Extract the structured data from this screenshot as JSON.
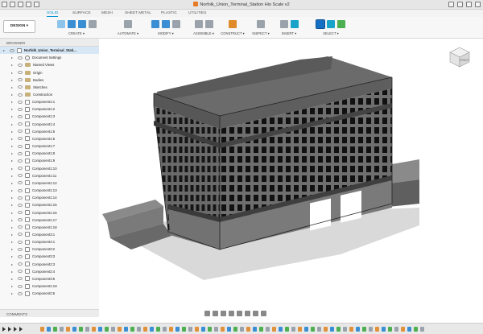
{
  "window": {
    "title": "Norfolk_Union_Terminal_Station Hio Scale v2"
  },
  "ribbon": {
    "tabs": [
      {
        "label": "SOLID",
        "active": true
      },
      {
        "label": "SURFACE",
        "active": false
      },
      {
        "label": "MESH",
        "active": false
      },
      {
        "label": "SHEET METAL",
        "active": false
      },
      {
        "label": "PLASTIC",
        "active": false
      },
      {
        "label": "UTILITIES",
        "active": false
      }
    ],
    "workspace_label": "DESIGN ▾",
    "groups": [
      {
        "label": "CREATE ▾",
        "icons": [
          "new-component-icon",
          "extrude-icon",
          "revolve-icon",
          "hole-icon"
        ]
      },
      {
        "label": "AUTOMATE ▾",
        "icons": [
          "automate-icon"
        ]
      },
      {
        "label": "MODIFY ▾",
        "icons": [
          "press-pull-icon",
          "fillet-icon",
          "move-icon"
        ]
      },
      {
        "label": "ASSEMBLE ▾",
        "icons": [
          "joint-icon",
          "as-built-joint-icon"
        ]
      },
      {
        "label": "CONSTRUCT ▾",
        "icons": [
          "offset-plane-icon"
        ]
      },
      {
        "label": "INSPECT ▾",
        "icons": [
          "measure-icon"
        ]
      },
      {
        "label": "INSERT ▾",
        "icons": [
          "insert-icon",
          "decal-icon"
        ]
      },
      {
        "label": "SELECT ▾",
        "icons": [
          "select-icon",
          "window-select-icon",
          "body-icon"
        ]
      }
    ]
  },
  "browser": {
    "header": "BROWSER",
    "items": [
      {
        "label": "Norfolk_Union_Terminal_Stati...",
        "type": "root"
      },
      {
        "label": "Document Settings",
        "type": "settings"
      },
      {
        "label": "Named Views",
        "type": "folder"
      },
      {
        "label": "Origin",
        "type": "folder"
      },
      {
        "label": "Bodies",
        "type": "folder"
      },
      {
        "label": "Sketches",
        "type": "folder"
      },
      {
        "label": "Construction",
        "type": "folder"
      },
      {
        "label": "Component1:1",
        "type": "component"
      },
      {
        "label": "Component1:2",
        "type": "component"
      },
      {
        "label": "Component1:3",
        "type": "component"
      },
      {
        "label": "Component1:4",
        "type": "component"
      },
      {
        "label": "Component1:5",
        "type": "component"
      },
      {
        "label": "Component1:6",
        "type": "component"
      },
      {
        "label": "Component1:7",
        "type": "component"
      },
      {
        "label": "Component1:8",
        "type": "component"
      },
      {
        "label": "Component1:9",
        "type": "component"
      },
      {
        "label": "Component1:10",
        "type": "component"
      },
      {
        "label": "Component1:11",
        "type": "component"
      },
      {
        "label": "Component1:12",
        "type": "component"
      },
      {
        "label": "Component1:13",
        "type": "component"
      },
      {
        "label": "Component1:14",
        "type": "component"
      },
      {
        "label": "Component1:15",
        "type": "component"
      },
      {
        "label": "Component1:16",
        "type": "component"
      },
      {
        "label": "Component1:17",
        "type": "component"
      },
      {
        "label": "Component1:18",
        "type": "component"
      },
      {
        "label": "Component3:1",
        "type": "component"
      },
      {
        "label": "Component4:1",
        "type": "component"
      },
      {
        "label": "Component3:2",
        "type": "component"
      },
      {
        "label": "Component3:3",
        "type": "component"
      },
      {
        "label": "Component2:3",
        "type": "component"
      },
      {
        "label": "Component2:4",
        "type": "component"
      },
      {
        "label": "Component3:5",
        "type": "component"
      },
      {
        "label": "Component1:19",
        "type": "component"
      },
      {
        "label": "Component2:6",
        "type": "component"
      }
    ]
  },
  "comments": {
    "label": "COMMENTS"
  },
  "viewcube": {
    "label": "FRONT"
  }
}
